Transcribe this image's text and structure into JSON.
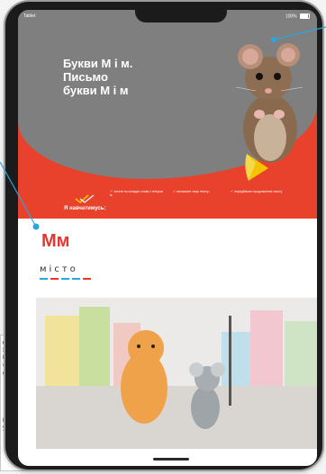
{
  "background_doc": {
    "lines": [
      "О",
      "З",
      "Ва",
      "ав",
      "до",
      "Н",
      "ув"
    ]
  },
  "status_bar": {
    "device": "Tablet",
    "battery": "100%"
  },
  "hero": {
    "title_lines": [
      "Букви М і м.",
      "Письмо",
      "букви М і м"
    ],
    "learn_label": "Я навчатимусь:",
    "goals": [
      "читати по складах слова з літерою м;",
      "визначати тему тексту;",
      "передбачати продовження тексту."
    ]
  },
  "content": {
    "letter": "Мм",
    "word_letters": [
      "м",
      "і",
      "с",
      "т",
      "о"
    ]
  },
  "colors": {
    "accent_red": "#e8412c",
    "hero_gray": "#7f7f7f",
    "play_yellow": "#f5c400",
    "callout_blue": "#2aa6df"
  }
}
